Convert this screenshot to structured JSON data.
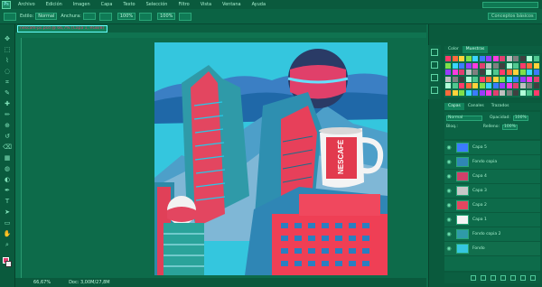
{
  "app": {
    "logo": "Ps"
  },
  "menu": [
    "Archivo",
    "Edición",
    "Imagen",
    "Capa",
    "Texto",
    "Selección",
    "Filtro",
    "Vista",
    "Ventana",
    "Ayuda"
  ],
  "options": {
    "estilo_label": "Estilo:",
    "estilo_value": "Normal",
    "anchura_label": "Anchura:",
    "opacity_value": "100%",
    "flow_value": "100%",
    "workspace": "Conceptos básicos"
  },
  "document": {
    "tab_title": "nescafe-ps.psd @ 66,7% (Capa 1, RGB/8)"
  },
  "status": {
    "zoom": "66,67%",
    "doc_info": "Doc: 3,00M/27,8M"
  },
  "panels": {
    "top_tabs": [
      "Color",
      "Muestras"
    ],
    "mid_tabs": [
      "Capas",
      "Canales",
      "Trazados"
    ],
    "blend_mode": "Normal",
    "opacity_label": "Opacidad:",
    "opacity_value": "100%",
    "lock_label": "Bloq.:",
    "fill_label": "Relleno:",
    "fill_value": "100%"
  },
  "layers": [
    {
      "name": "Capa 5",
      "selected": false
    },
    {
      "name": "Fondo copia",
      "selected": false
    },
    {
      "name": "Capa 4",
      "selected": false
    },
    {
      "name": "Capa 3",
      "selected": false
    },
    {
      "name": "Capa 2",
      "selected": false
    },
    {
      "name": "Capa 1",
      "selected": false
    },
    {
      "name": "Fondo copia 2",
      "selected": false
    },
    {
      "name": "Fondo",
      "selected": true
    }
  ],
  "canvas_text": {
    "mug_brand": "NESCAFÉ"
  },
  "colors": {
    "sky": "#35c7e0",
    "building_red": "#e8405a",
    "ui_bg": "#0d6b4a",
    "ui_dark": "#0a5a3d"
  }
}
